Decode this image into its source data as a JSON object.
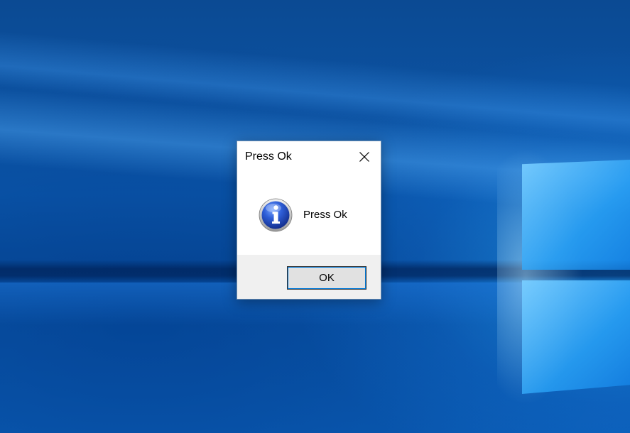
{
  "dialog": {
    "title": "Press Ok",
    "message": "Press Ok",
    "icon": "information-icon",
    "buttons": {
      "ok_label": "OK"
    }
  },
  "colors": {
    "desktop_blue": "#0b58ad",
    "dialog_bg": "#ffffff",
    "button_area_bg": "#f0f0f0",
    "button_bg": "#e1e1e1",
    "focus_blue": "#0078d7"
  }
}
